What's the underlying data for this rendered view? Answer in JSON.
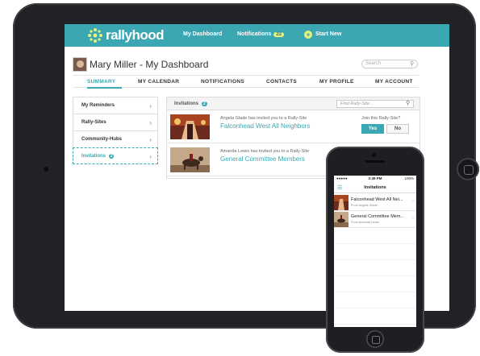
{
  "app": {
    "brand": "rallyhood",
    "nav": {
      "dashboard": "My Dashboard",
      "notifications": "Notifications",
      "notifications_count": "22",
      "start_new": "Start New"
    }
  },
  "header": {
    "title": "Mary Miller - My Dashboard",
    "search_placeholder": "Search"
  },
  "tabs": [
    "SUMMARY",
    "MY CALENDAR",
    "NOTIFICATIONS",
    "CONTACTS",
    "MY PROFILE",
    "MY ACCOUNT"
  ],
  "menu": {
    "reminders": "My Reminders",
    "rally_sites": "Rally-Sites",
    "community_hubs": "Community-Hubs",
    "invitations": "Invitations",
    "invitations_count": "2"
  },
  "invitations": {
    "title": "Invitations",
    "count": "2",
    "search_placeholder": "Find Rally-Site...",
    "join_question": "Join this Rally-Site?",
    "yes_label": "Yes",
    "no_label": "No",
    "items": [
      {
        "from": "Angela Glade has invited you to a Rally-Site",
        "name": "Falconhead West All Neighbors"
      },
      {
        "from": "Amanda Lewis has invited you to a Rally-Site",
        "name": "General Committee Members"
      }
    ]
  },
  "phone": {
    "carrier": "●●●●● ",
    "time": "2:49 PM",
    "battery": "100%",
    "title": "Invitations",
    "items": [
      {
        "title": "Falconhead West All Nei...",
        "from": "From Angela Glade"
      },
      {
        "title": "General Committee Mem...",
        "from": "From Amanda Lewis"
      }
    ]
  },
  "colors": {
    "accent": "#3aa7b3",
    "highlight": "#e7f37a"
  }
}
